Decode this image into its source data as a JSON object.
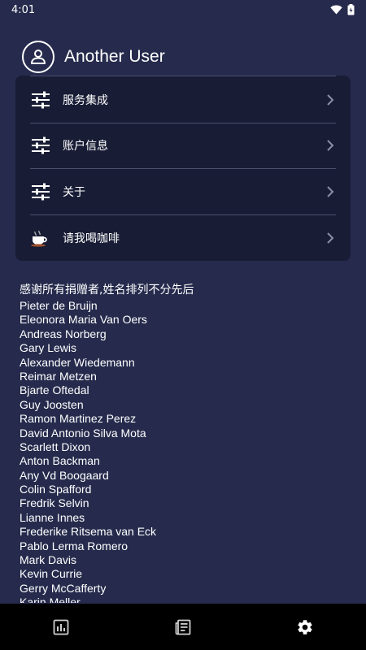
{
  "status_bar": {
    "time": "4:01",
    "icons": [
      "wifi-icon",
      "battery-icon"
    ]
  },
  "header": {
    "user_name": "Another User",
    "avatar_icon": "user-circle-icon"
  },
  "menu": [
    {
      "label": "服务集成",
      "icon": "sliders-icon"
    },
    {
      "label": "账户信息",
      "icon": "sliders-icon"
    },
    {
      "label": "关于",
      "icon": "sliders-icon"
    },
    {
      "label": "请我喝咖啡",
      "icon": "coffee-icon"
    }
  ],
  "donors": {
    "title": "感谢所有捐赠者,姓名排列不分先后",
    "names": [
      "Pieter de Bruijn",
      "Eleonora Maria Van Oers",
      "Andreas Norberg",
      "Gary Lewis",
      "Alexander Wiedemann",
      "Reimar Metzen",
      "Bjarte Oftedal",
      "Guy Joosten",
      "Ramon Martinez Perez",
      "David Antonio Silva Mota",
      "Scarlett Dixon",
      "Anton Backman",
      "Any Vd Boogaard",
      "Colin Spafford",
      "Fredrik Selvin",
      "Lianne Innes",
      "Frederike Ritsema van Eck",
      "Pablo Lerma Romero",
      "Mark Davis",
      "Kevin Currie",
      "Gerry McCafferty",
      "Karin Meller"
    ]
  },
  "bottom_nav": [
    {
      "icon": "chart-icon"
    },
    {
      "icon": "news-icon"
    },
    {
      "icon": "gear-icon"
    }
  ],
  "colors": {
    "background": "#262b4d",
    "card": "#181c35",
    "nav": "#000000",
    "text": "#ffffff"
  }
}
